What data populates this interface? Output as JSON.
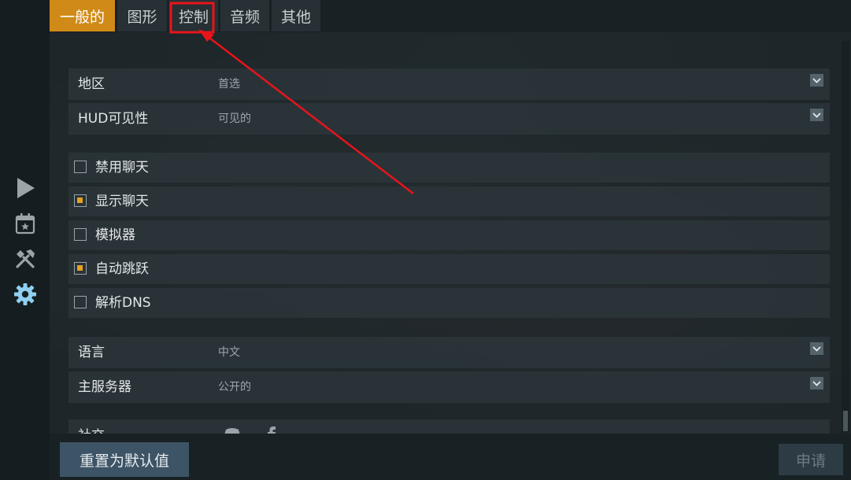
{
  "tabs": [
    {
      "label": "一般的",
      "active": true
    },
    {
      "label": "图形",
      "active": false
    },
    {
      "label": "控制",
      "active": false
    },
    {
      "label": "音频",
      "active": false
    },
    {
      "label": "其他",
      "active": false
    }
  ],
  "sidebar": {
    "items": [
      {
        "icon": "play-icon",
        "active": false
      },
      {
        "icon": "calendar-star-icon",
        "active": false
      },
      {
        "icon": "tools-icon",
        "active": false
      },
      {
        "icon": "gear-icon",
        "active": true
      }
    ]
  },
  "settings": {
    "region": {
      "label": "地区",
      "value": "首选"
    },
    "hud": {
      "label": "HUD可见性",
      "value": "可见的"
    },
    "checkboxes": [
      {
        "label": "禁用聊天",
        "checked": false
      },
      {
        "label": "显示聊天",
        "checked": true
      },
      {
        "label": "模拟器",
        "checked": false
      },
      {
        "label": "自动跳跃",
        "checked": true
      },
      {
        "label": "解析DNS",
        "checked": false
      }
    ],
    "language": {
      "label": "语言",
      "value": "中文"
    },
    "master_server": {
      "label": "主服务器",
      "value": "公开的"
    },
    "social": {
      "label": "社交"
    }
  },
  "footer": {
    "reset_label": "重置为默认值",
    "apply_label": "申请"
  },
  "colors": {
    "accent": "#d08a17",
    "checkbox_on": "#e3a321",
    "annotation": "#e8141c"
  }
}
